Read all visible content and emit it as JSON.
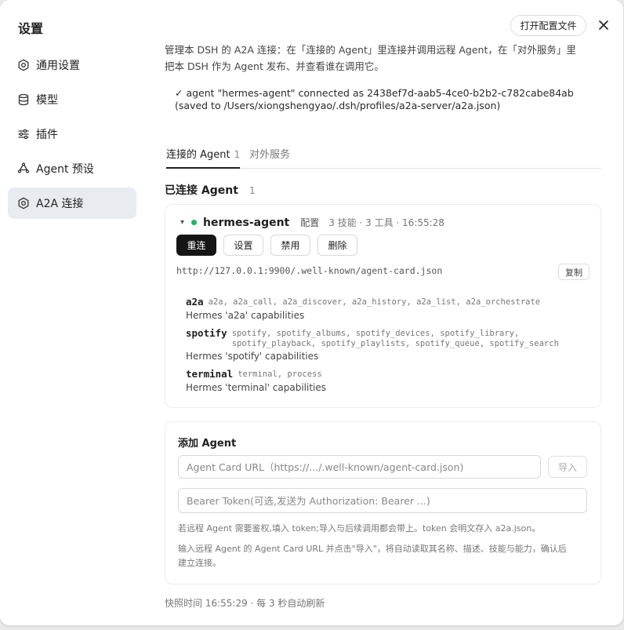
{
  "dialog": {
    "title": "设置"
  },
  "header": {
    "open_config_label": "打开配置文件"
  },
  "sidebar": {
    "items": [
      {
        "label": "通用设置",
        "icon": "gear-icon",
        "active": false
      },
      {
        "label": "模型",
        "icon": "database-icon",
        "active": false
      },
      {
        "label": "插件",
        "icon": "sliders-icon",
        "active": false
      },
      {
        "label": "Agent 预设",
        "icon": "recycle-icon",
        "active": false
      },
      {
        "label": "A2A 连接",
        "icon": "gear-icon",
        "active": true
      }
    ]
  },
  "main": {
    "intro_line1": "管理本 DSH 的 A2A 连接：在「连接的 Agent」里连接并调用远程 Agent，在「对外服务」里",
    "intro_line2": "把本 DSH 作为 Agent 发布、并查看谁在调用它。",
    "status_line1": "✓ agent \"hermes-agent\" connected as 2438ef7d-aab5-4ce0-b2b2-c782cabe84ab",
    "status_line2": "(saved to /Users/xiongshengyao/.dsh/profiles/a2a-server/a2a.json)",
    "tabs": [
      {
        "label": "连接的 Agent",
        "count": "1",
        "active": true
      },
      {
        "label": "对外服务",
        "count": "",
        "active": false
      }
    ],
    "connected_title": "已连接 Agent",
    "connected_count": "1"
  },
  "agent": {
    "caret": "▾",
    "name": "hermes-agent",
    "config_label": "配置",
    "meta": "3 技能 · 3 工具 · 16:55:28",
    "status_color": "#22b35e",
    "buttons": {
      "reconnect": "重连",
      "settings": "设置",
      "disable": "禁用",
      "delete": "删除"
    },
    "card_url": "http://127.0.0.1:9900/.well-known/agent-card.json",
    "copy_label": "复制",
    "skills": [
      {
        "name": "a2a",
        "tools_line1": "a2a, a2a_call, a2a_discover, a2a_history, a2a_list, a2a_orchestrate",
        "tools_line2": "",
        "desc": "Hermes 'a2a' capabilities"
      },
      {
        "name": "spotify",
        "tools_line1": "spotify, spotify_albums, spotify_devices, spotify_library,",
        "tools_line2": "spotify_playback, spotify_playlists, spotify_queue, spotify_search",
        "desc": "Hermes 'spotify' capabilities"
      },
      {
        "name": "terminal",
        "tools_line1": "terminal, process",
        "tools_line2": "",
        "desc": "Hermes 'terminal' capabilities"
      }
    ]
  },
  "add_agent": {
    "title": "添加 Agent",
    "url_placeholder": "Agent Card URL（https://.../.well-known/agent-card.json)",
    "import_label": "导入",
    "token_placeholder": "Bearer Token(可选,发送为 Authorization: Bearer ...)",
    "hint1": "若远程 Agent 需要鉴权,填入 token;导入与后续调用都会带上。token 会明文存入 a2a.json。",
    "hint2_line1": "输入远程 Agent 的 Agent Card URL 并点击\"导入\"，将自动读取其名称、描述、技能与能力，确认后",
    "hint2_line2": "建立连接。"
  },
  "footer": {
    "snapshot": "快照时间 16:55:29 · 每 3 秒自动刷新"
  }
}
